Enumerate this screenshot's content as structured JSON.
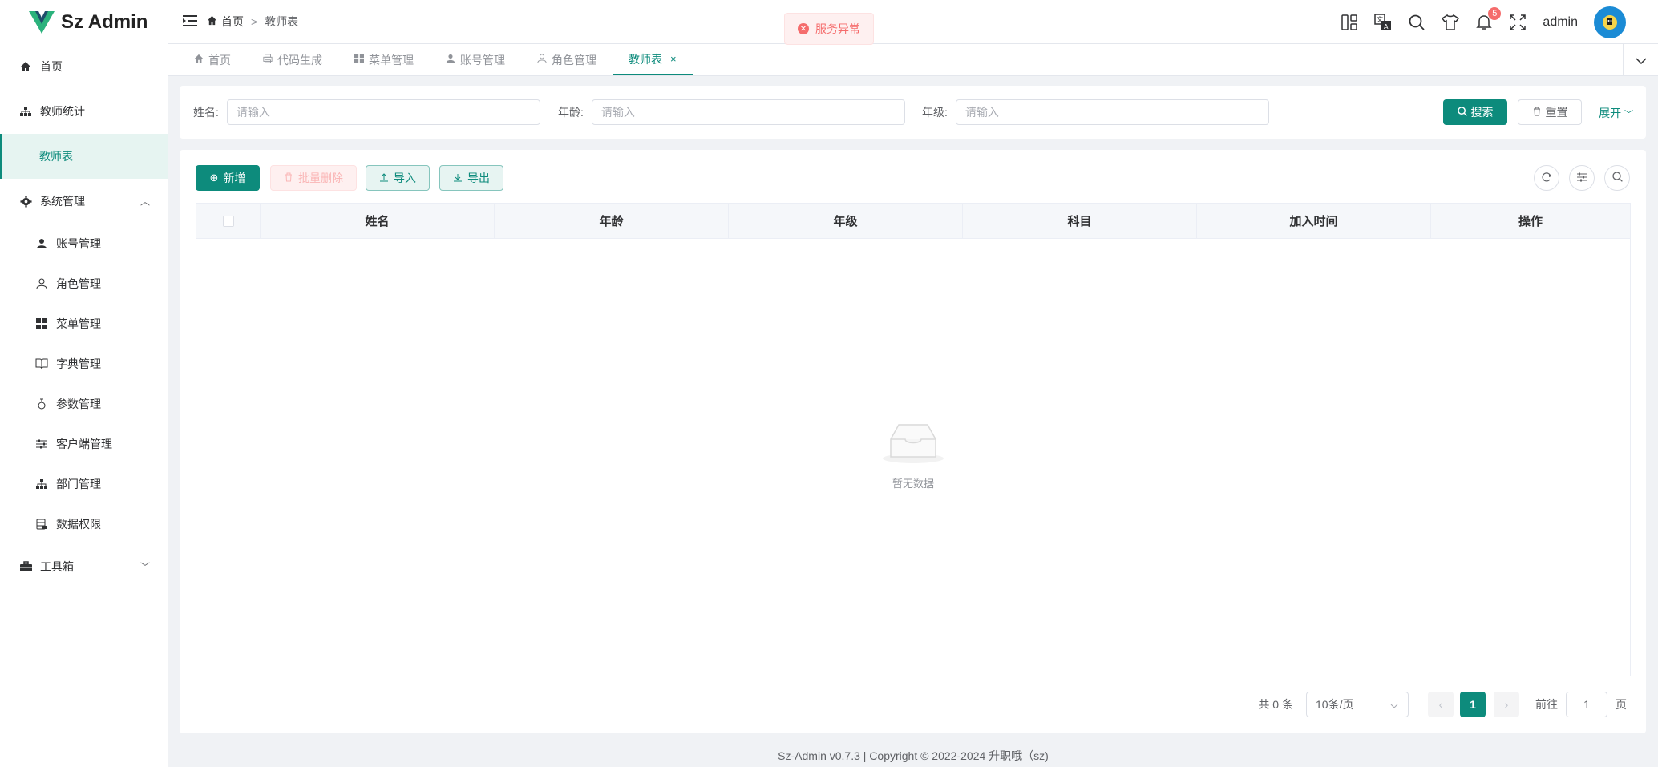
{
  "app": {
    "title": "Sz Admin"
  },
  "sidebar": {
    "items": [
      {
        "label": "首页"
      },
      {
        "label": "教师统计"
      },
      {
        "label": "教师表"
      },
      {
        "label": "系统管理"
      },
      {
        "label": "工具箱"
      }
    ],
    "system_children": [
      {
        "label": "账号管理"
      },
      {
        "label": "角色管理"
      },
      {
        "label": "菜单管理"
      },
      {
        "label": "字典管理"
      },
      {
        "label": "参数管理"
      },
      {
        "label": "客户端管理"
      },
      {
        "label": "部门管理"
      },
      {
        "label": "数据权限"
      }
    ]
  },
  "header": {
    "breadcrumb": [
      "首页",
      "教师表"
    ],
    "notification_count": "5",
    "username": "admin",
    "message": "服务异常"
  },
  "tabs": [
    {
      "label": "首页"
    },
    {
      "label": "代码生成"
    },
    {
      "label": "菜单管理"
    },
    {
      "label": "账号管理"
    },
    {
      "label": "角色管理"
    },
    {
      "label": "教师表"
    }
  ],
  "search": {
    "fields": [
      {
        "label": "姓名:",
        "placeholder": "请输入"
      },
      {
        "label": "年龄:",
        "placeholder": "请输入"
      },
      {
        "label": "年级:",
        "placeholder": "请输入"
      }
    ],
    "search_label": "搜索",
    "reset_label": "重置",
    "expand_label": "展开"
  },
  "toolbar": {
    "add_label": "新增",
    "batch_delete_label": "批量删除",
    "import_label": "导入",
    "export_label": "导出"
  },
  "table": {
    "columns": [
      "姓名",
      "年龄",
      "年级",
      "科目",
      "加入时间",
      "操作"
    ],
    "empty_text": "暂无数据"
  },
  "pagination": {
    "total_text": "共 0 条",
    "page_size": "10条/页",
    "current_page": "1",
    "goto_label": "前往",
    "goto_value": "1",
    "page_unit": "页"
  },
  "footer": {
    "text": "Sz-Admin v0.7.3 | Copyright © 2022-2024 升职哦（sz)"
  },
  "colors": {
    "primary": "#0d8b7c",
    "danger": "#f56c6c"
  }
}
